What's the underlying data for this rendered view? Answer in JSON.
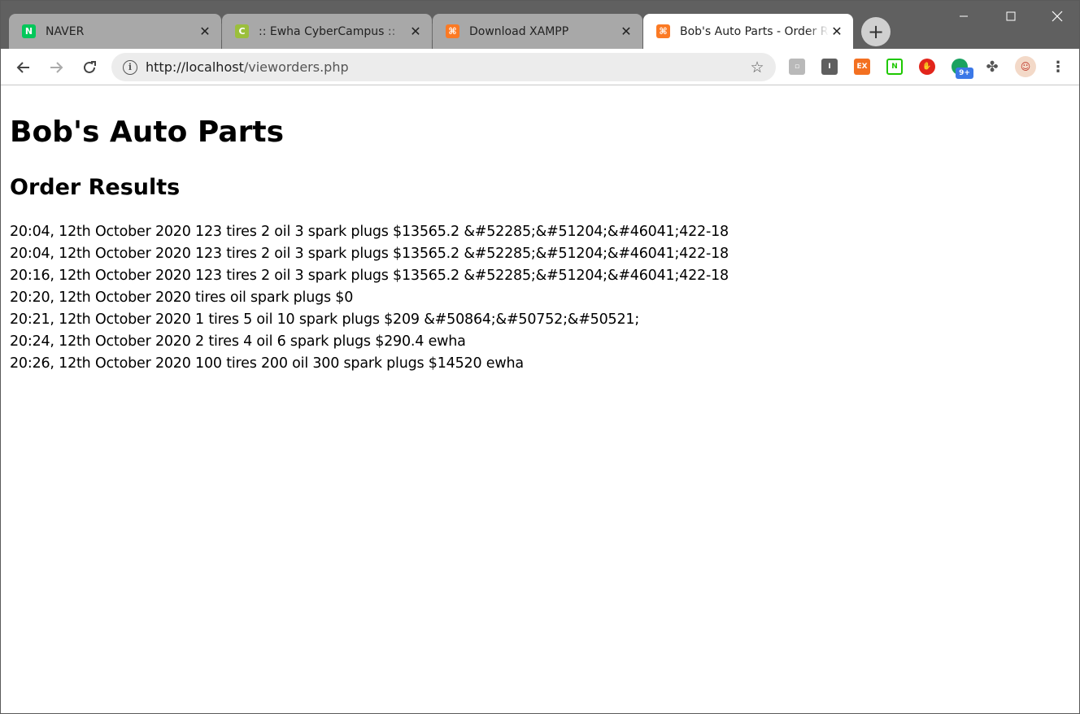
{
  "browser": {
    "tabs": [
      {
        "title": "NAVER",
        "favicon": "naver-icon",
        "favicon_text": "N",
        "favicon_color": "#03c75a",
        "active": false
      },
      {
        "title": ":: Ewha CyberCampus ::",
        "favicon": "cybercampus-icon",
        "favicon_text": "C",
        "favicon_color": "#9bbf3c",
        "active": false
      },
      {
        "title": "Download XAMPP",
        "favicon": "xampp-icon",
        "favicon_text": "⌘",
        "favicon_color": "#fb7a24",
        "active": false
      },
      {
        "title": "Bob's Auto Parts - Order Results",
        "favicon": "xampp-icon",
        "favicon_text": "⌘",
        "favicon_color": "#fb7a24",
        "active": true
      }
    ],
    "new_tab_label": "+",
    "address": {
      "scheme_host": "http://localhost",
      "path": "/vieworders.php"
    },
    "extension_badge": "9+"
  },
  "page": {
    "heading": "Bob's Auto Parts",
    "subheading": "Order Results",
    "orders": [
      "20:04, 12th October 2020 123 tires 2 oil 3 spark plugs $13565.2 &#52285;&#51204;&#46041;422-18",
      "20:04, 12th October 2020 123 tires 2 oil 3 spark plugs $13565.2 &#52285;&#51204;&#46041;422-18",
      "20:16, 12th October 2020 123 tires 2 oil 3 spark plugs $13565.2 &#52285;&#51204;&#46041;422-18",
      "20:20, 12th October 2020 tires oil spark plugs $0",
      "20:21, 12th October 2020 1 tires 5 oil 10 spark plugs $209 &#50864;&#50752;&#50521;",
      "20:24, 12th October 2020 2 tires 4 oil 6 spark plugs $290.4 ewha",
      "20:26, 12th October 2020 100 tires 200 oil 300 spark plugs $14520 ewha"
    ]
  }
}
